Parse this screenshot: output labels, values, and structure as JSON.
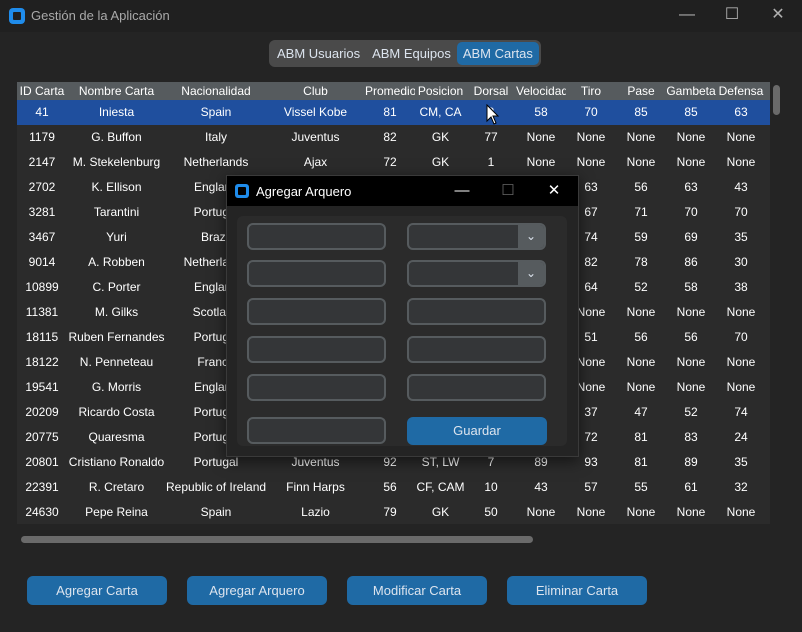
{
  "window": {
    "title": "Gestión de la Aplicación",
    "minimize": "—",
    "maximize": "☐",
    "close": "✕"
  },
  "tabs": [
    {
      "label": "ABM Usuarios",
      "active": false
    },
    {
      "label": "ABM Equipos",
      "active": false
    },
    {
      "label": "ABM Cartas",
      "active": true
    }
  ],
  "table": {
    "columns": [
      "ID Carta",
      "Nombre Carta",
      "Nacionalidad",
      "Club",
      "Promedio",
      "Posicion",
      "Dorsal",
      "Velocidad",
      "Tiro",
      "Pase",
      "Gambeta",
      "Defensa"
    ],
    "rows": [
      [
        "41",
        "Iniesta",
        "Spain",
        "Vissel Kobe",
        "81",
        "CM, CA",
        "8",
        "58",
        "70",
        "85",
        "85",
        "63"
      ],
      [
        "1179",
        "G. Buffon",
        "Italy",
        "Juventus",
        "82",
        "GK",
        "77",
        "None",
        "None",
        "None",
        "None",
        "None"
      ],
      [
        "2147",
        "M. Stekelenburg",
        "Netherlands",
        "Ajax",
        "72",
        "GK",
        "1",
        "None",
        "None",
        "None",
        "None",
        "None"
      ],
      [
        "2702",
        "K. Ellison",
        "England",
        "",
        "",
        "",
        "",
        "",
        "63",
        "56",
        "63",
        "43"
      ],
      [
        "3281",
        "Tarantini",
        "Portugal",
        "",
        "",
        "",
        "",
        "",
        "67",
        "71",
        "70",
        "70"
      ],
      [
        "3467",
        "Yuri",
        "Brazil",
        "",
        "",
        "",
        "",
        "",
        "74",
        "59",
        "69",
        "35"
      ],
      [
        "9014",
        "A. Robben",
        "Netherlands",
        "",
        "",
        "",
        "",
        "",
        "82",
        "78",
        "86",
        "30"
      ],
      [
        "10899",
        "C. Porter",
        "England",
        "",
        "",
        "",
        "",
        "",
        "64",
        "52",
        "58",
        "38"
      ],
      [
        "11381",
        "M. Gilks",
        "Scotland",
        "",
        "",
        "",
        "",
        "",
        "None",
        "None",
        "None",
        "None"
      ],
      [
        "18115",
        "Ruben Fernandes",
        "Portugal",
        "",
        "",
        "",
        "",
        "",
        "51",
        "56",
        "56",
        "70"
      ],
      [
        "18122",
        "N. Penneteau",
        "France",
        "",
        "",
        "",
        "",
        "",
        "None",
        "None",
        "None",
        "None"
      ],
      [
        "19541",
        "G. Morris",
        "England",
        "",
        "",
        "",
        "",
        "",
        "None",
        "None",
        "None",
        "None"
      ],
      [
        "20209",
        "Ricardo Costa",
        "Portugal",
        "",
        "",
        "",
        "",
        "",
        "37",
        "47",
        "52",
        "74"
      ],
      [
        "20775",
        "Quaresma",
        "Portugal",
        "",
        "",
        "",
        "",
        "",
        "72",
        "81",
        "83",
        "24"
      ],
      [
        "20801",
        "Cristiano Ronaldo",
        "Portugal",
        "Juventus",
        "92",
        "ST, LW",
        "7",
        "89",
        "93",
        "81",
        "89",
        "35"
      ],
      [
        "22391",
        "R. Cretaro",
        "Republic of Ireland",
        "Finn Harps",
        "56",
        "CF, CAM",
        "10",
        "43",
        "57",
        "55",
        "61",
        "32"
      ],
      [
        "24630",
        "Pepe Reina",
        "Spain",
        "Lazio",
        "79",
        "GK",
        "50",
        "None",
        "None",
        "None",
        "None",
        "None"
      ]
    ]
  },
  "buttons": {
    "add_card": "Agregar Carta",
    "add_goalkeeper": "Agregar Arquero",
    "modify_card": "Modificar Carta",
    "delete_card": "Eliminar Carta"
  },
  "dialog": {
    "title": "Agregar Arquero",
    "minimize": "—",
    "maximize": "☐",
    "close": "✕",
    "save_label": "Guardar",
    "dropdown_arrow": "⌄"
  },
  "colors": {
    "accent": "#1f6aa5",
    "selected_row": "#1f4f9e",
    "header_bg": "#565b5e"
  }
}
